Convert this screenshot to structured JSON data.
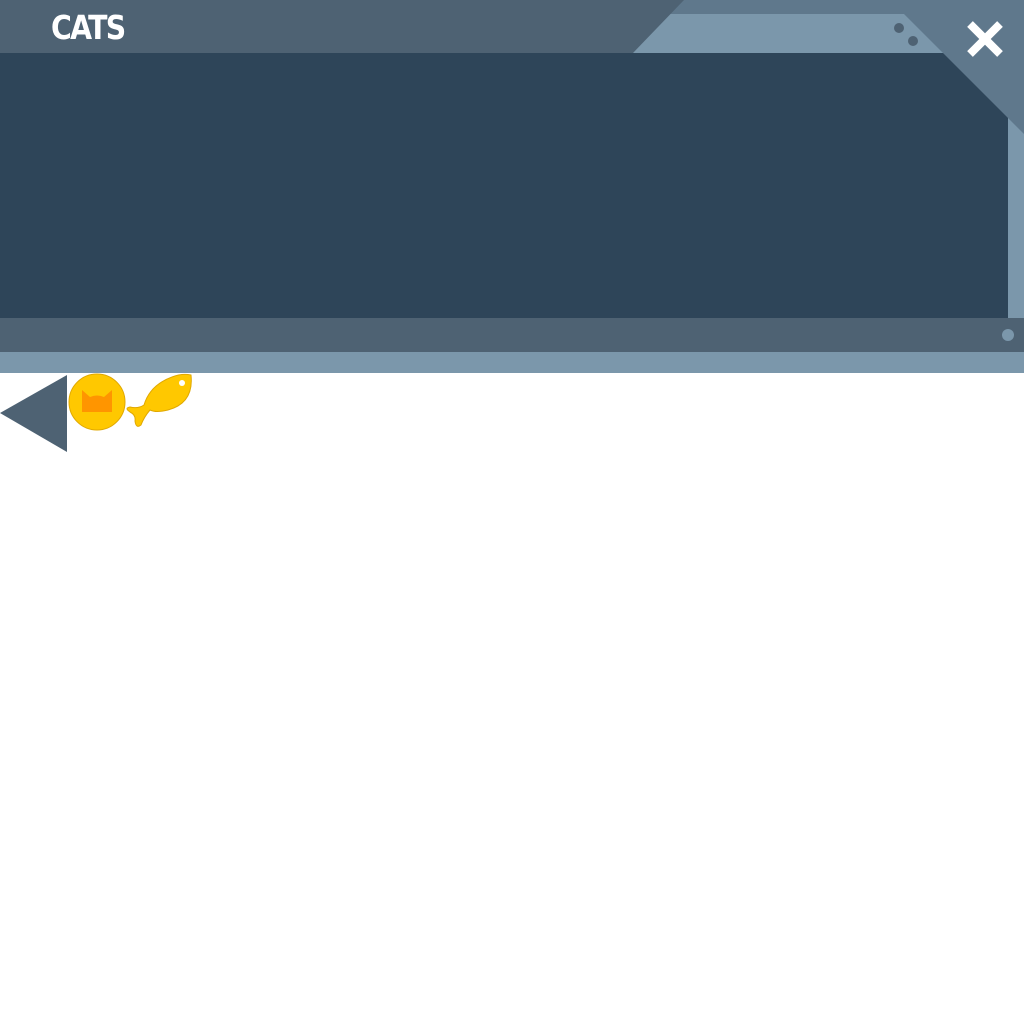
{
  "window": {
    "title": "CATS"
  },
  "colors": {
    "content_bg": "#2e4559",
    "header_bg": "#4e6273",
    "frame_light": "#7b97ab",
    "corner_plate": "#5f788c",
    "accent_yellow": "#ffc800",
    "accent_orange": "#ff9500",
    "icon_white": "#ffffff"
  },
  "icons": {
    "close": "close-icon",
    "back": "back-arrow-icon",
    "cat": "cat-head-icon",
    "fish": "fish-icon"
  }
}
